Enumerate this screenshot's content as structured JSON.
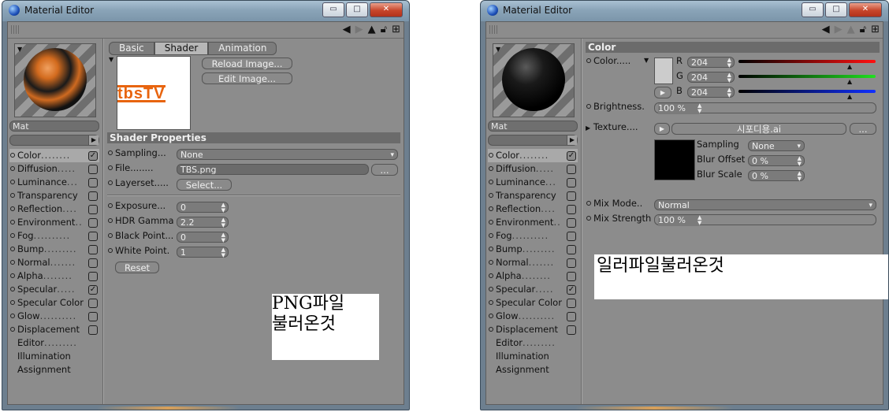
{
  "left_window": {
    "title": "Material Editor",
    "window_buttons": {
      "minimize": "▭",
      "maximize": "□",
      "close": "✕"
    },
    "toolbar_icons": [
      "arrow-left-icon",
      "arrow-right-icon",
      "arrow-up-icon",
      "lock-icon",
      "expand-icon"
    ],
    "material_name": "Mat",
    "channels": [
      {
        "label": "Color",
        "dots": "........",
        "checked": true,
        "selected": true
      },
      {
        "label": "Diffusion",
        "dots": ".....",
        "checked": false
      },
      {
        "label": "Luminance",
        "dots": "...",
        "checked": false
      },
      {
        "label": "Transparency",
        "dots": "",
        "checked": false
      },
      {
        "label": "Reflection",
        "dots": "....",
        "checked": false
      },
      {
        "label": "Environment",
        "dots": "..",
        "checked": false
      },
      {
        "label": "Fog",
        "dots": "..........",
        "checked": false
      },
      {
        "label": "Bump",
        "dots": ".........",
        "checked": false
      },
      {
        "label": "Normal",
        "dots": ".......",
        "checked": false
      },
      {
        "label": "Alpha",
        "dots": "........",
        "checked": false
      },
      {
        "label": "Specular",
        "dots": ".....",
        "checked": true
      },
      {
        "label": "Specular Color",
        "dots": "",
        "checked": false
      },
      {
        "label": "Glow",
        "dots": "..........",
        "checked": false
      },
      {
        "label": "Displacement",
        "dots": "",
        "checked": false
      }
    ],
    "extra_items": [
      {
        "label": "Editor",
        "dots": "........."
      },
      {
        "label": "Illumination",
        "dots": ""
      },
      {
        "label": "Assignment",
        "dots": ""
      }
    ],
    "tabs": [
      "Basic",
      "Shader",
      "Animation"
    ],
    "active_tab": "Shader",
    "reload_button": "Reload Image...",
    "edit_button": "Edit Image...",
    "thumbnail_logo": "tbsTV",
    "section_title": "Shader Properties",
    "sampling_label": "Sampling",
    "sampling_value": "None",
    "file_label": "File",
    "file_value": "TBS.png",
    "browse_button": "...",
    "layerset_label": "Layerset",
    "select_button": "Select...",
    "exposure_label": "Exposure",
    "exposure_value": "0",
    "hdr_label": "HDR Gamma",
    "hdr_value": "2.2",
    "black_label": "Black Point",
    "black_value": "0",
    "white_label": "White Point",
    "white_value": "1",
    "reset_button": "Reset",
    "note_line1": "PNG파일",
    "note_line2": "불러온것"
  },
  "right_window": {
    "title": "Material Editor",
    "material_name": "Mat",
    "section_title": "Color",
    "color_label": "Color",
    "r_label": "R",
    "r_value": "204",
    "g_label": "G",
    "g_value": "204",
    "b_label": "B",
    "b_value": "204",
    "brightness_label": "Brightness",
    "brightness_value": "100 %",
    "texture_label": "Texture",
    "texture_value": "시포디용.ai",
    "texture_browse": "...",
    "sampling_label": "Sampling",
    "sampling_value": "None",
    "bluroffset_label": "Blur Offset",
    "bluroffset_value": "0 %",
    "blurscale_label": "Blur Scale",
    "blurscale_value": "0 %",
    "mixmode_label": "Mix Mode",
    "mixmode_value": "Normal",
    "mixstrength_label": "Mix Strength",
    "mixstrength_value": "100 %",
    "note": "일러파일불러온것",
    "swatch_color": "#cccccc"
  }
}
